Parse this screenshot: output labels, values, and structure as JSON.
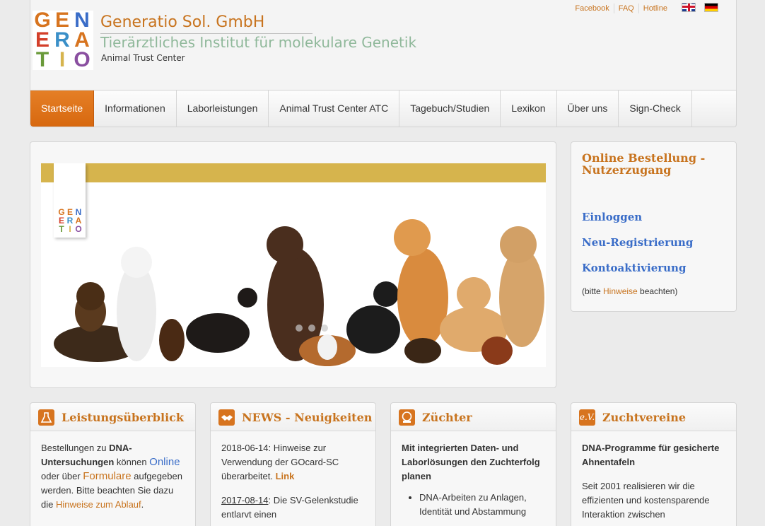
{
  "header": {
    "logo_rows": [
      [
        "G",
        "E",
        "N"
      ],
      [
        "E",
        "R",
        "A"
      ],
      [
        "T",
        "I",
        "O"
      ]
    ],
    "company": "Generatio Sol. GmbH",
    "subtitle": "Tierärztliches Institut für molekulare Genetik",
    "tagline": "Animal Trust Center",
    "toplinks": [
      "Facebook",
      "FAQ",
      "Hotline"
    ]
  },
  "nav": {
    "items": [
      "Startseite",
      "Informationen",
      "Laborleistungen",
      "Animal Trust Center ATC",
      "Tagebuch/Studien",
      "Lexikon",
      "Über uns",
      "Sign-Check"
    ]
  },
  "login": {
    "title": "Online Bestellung - Nutzerzugang",
    "links": [
      "Einloggen",
      "Neu-Registrierung",
      "Kontoaktivierung"
    ],
    "note_pre": "(bitte ",
    "note_link": "Hinweise",
    "note_post": " beachten)"
  },
  "cards": {
    "leistung": {
      "title": "Leistungsüberblick",
      "t1": "Bestellungen zu ",
      "t2": "DNA-Untersuchungen",
      "t3": " können ",
      "t4": "Online",
      "t5": " oder über ",
      "t6": "Formulare",
      "t7": " aufgegeben werden. Bitte beachten Sie dazu die ",
      "t8": "Hinweise zum Ablauf",
      "t9": "."
    },
    "news": {
      "title": "NEWS - Neuigkeiten",
      "n1": "2018-06-14: Hinweise zur Verwendung der GOcard-SC überarbeitet. ",
      "n1_link": "Link",
      "n2_date": "2017-08-14",
      "n2_text": ": Die SV-Gelenkstudie entlarvt einen"
    },
    "zuechter": {
      "title": "Züchter",
      "lead": "Mit integrierten Daten- und Laborlösungen den Zuchterfolg planen",
      "bullet": "DNA-Arbeiten zu Anlagen, Identität und Abstammung"
    },
    "vereine": {
      "icon_text": "e.V.",
      "title": "Zuchtvereine",
      "lead": "DNA-Programme für gesicherte Ahnentafeln",
      "text": "Seit 2001 realisieren wir die effizienten und kostensparende Interaktion zwischen"
    }
  },
  "colors": {
    "accent": "#d7680f",
    "brand_orange": "#c8741f",
    "brand_green": "#8fb89a",
    "link_blue": "#3a6dc8",
    "slide_band": "#d6b44d"
  }
}
